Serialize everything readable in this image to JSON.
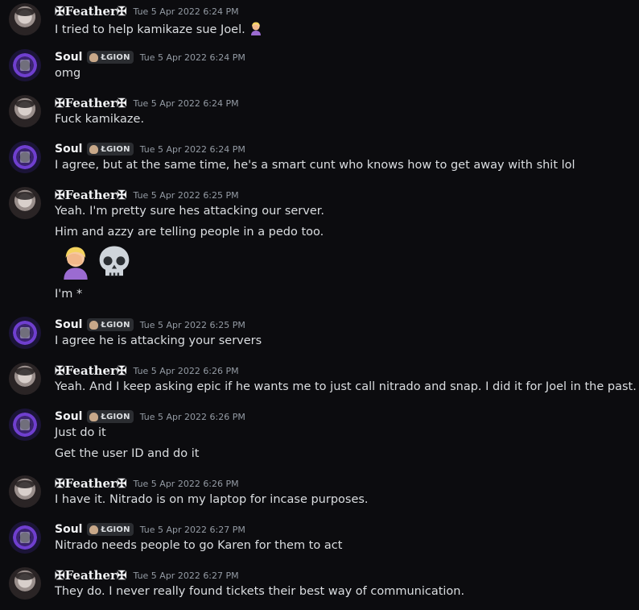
{
  "messages": [
    {
      "author": "✠Feather✠",
      "avatar": "feather",
      "tag": null,
      "time": "Tue 5 Apr 2022 6:24 PM",
      "lines": [
        "I tried to help kamikaze sue Joel."
      ],
      "emoji_after": "facepalm"
    },
    {
      "author": "Soul",
      "avatar": "soul",
      "tag": "ŁGION",
      "time": "Tue 5 Apr 2022 6:24 PM",
      "lines": [
        "omg"
      ]
    },
    {
      "author": "✠Feather✠",
      "avatar": "feather",
      "tag": null,
      "time": "Tue 5 Apr 2022 6:24 PM",
      "lines": [
        "Fuck kamikaze."
      ]
    },
    {
      "author": "Soul",
      "avatar": "soul",
      "tag": "ŁGION",
      "time": "Tue 5 Apr 2022 6:24 PM",
      "lines": [
        "I agree, but at the same time, he's a smart cunt who knows how to get away with shit lol"
      ]
    },
    {
      "author": "✠Feather✠",
      "avatar": "feather",
      "tag": null,
      "time": "Tue 5 Apr 2022 6:25 PM",
      "lines": [
        "Yeah. I'm pretty sure hes attacking our server.",
        "Him and azzy are telling people in a pedo too.",
        "I'm *"
      ],
      "big_emojis": [
        "facepalm",
        "skull"
      ]
    },
    {
      "author": "Soul",
      "avatar": "soul",
      "tag": "ŁGION",
      "time": "Tue 5 Apr 2022 6:25 PM",
      "lines": [
        "I agree he is attacking your servers"
      ]
    },
    {
      "author": "✠Feather✠",
      "avatar": "feather",
      "tag": null,
      "time": "Tue 5 Apr 2022 6:26 PM",
      "lines": [
        "Yeah. And I keep asking epic if he wants me to just call nitrado and snap. I did it for Joel in the past."
      ]
    },
    {
      "author": "Soul",
      "avatar": "soul",
      "tag": "ŁGION",
      "time": "Tue 5 Apr 2022 6:26 PM",
      "lines": [
        "Just do it",
        "Get the user ID and do it"
      ]
    },
    {
      "author": "✠Feather✠",
      "avatar": "feather",
      "tag": null,
      "time": "Tue 5 Apr 2022 6:26 PM",
      "lines": [
        "I have it. Nitrado is on my laptop for incase purposes."
      ]
    },
    {
      "author": "Soul",
      "avatar": "soul",
      "tag": "ŁGION",
      "time": "Tue 5 Apr 2022 6:27 PM",
      "lines": [
        "Nitrado needs people to go Karen for them to act"
      ]
    },
    {
      "author": "✠Feather✠",
      "avatar": "feather",
      "tag": null,
      "time": "Tue 5 Apr 2022 6:27 PM",
      "lines": [
        "They do. I never really found tickets their best way of communication."
      ]
    }
  ],
  "colors": {
    "background": "#0c0c0f",
    "text": "#dbdee1",
    "timestamp": "#949ba4",
    "tag_bg": "#2b2d31"
  }
}
